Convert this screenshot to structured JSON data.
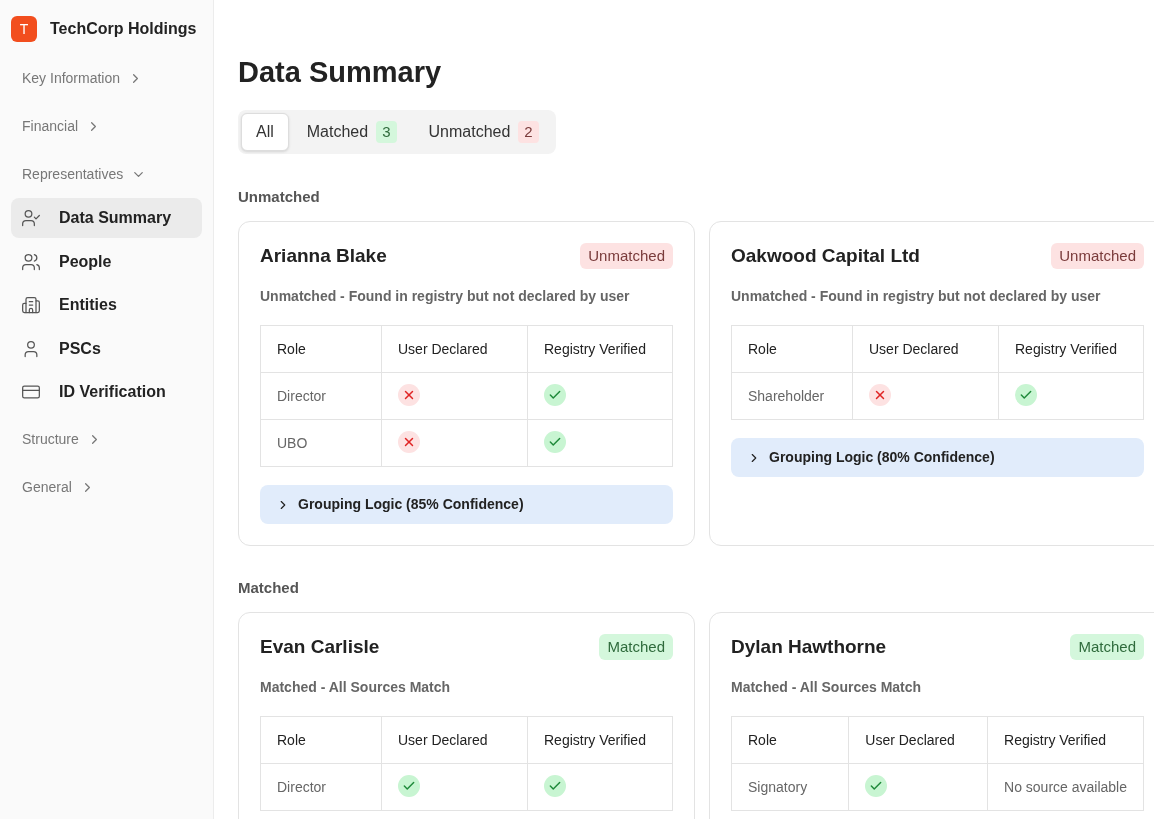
{
  "company": {
    "initial": "T",
    "name": "TechCorp Holdings"
  },
  "nav": [
    {
      "label": "Key Information",
      "expanded": false
    },
    {
      "label": "Financial",
      "expanded": false
    },
    {
      "label": "Representatives",
      "expanded": true,
      "children": [
        {
          "label": "Data Summary",
          "kind": "summary",
          "selected": true
        },
        {
          "label": "People",
          "kind": "people",
          "selected": false
        },
        {
          "label": "Entities",
          "kind": "entities",
          "selected": false
        },
        {
          "label": "PSCs",
          "kind": "pscs",
          "selected": false
        },
        {
          "label": "ID Verification",
          "kind": "verification",
          "selected": false
        }
      ]
    },
    {
      "label": "Structure",
      "expanded": false
    },
    {
      "label": "General",
      "expanded": false
    }
  ],
  "title": "Data Summary",
  "filters": [
    {
      "label": "All",
      "selected": true
    },
    {
      "label": "Matched",
      "count": "3",
      "kind": "matched",
      "selected": false
    },
    {
      "label": "Unmatched",
      "count": "2",
      "kind": "unmatched",
      "selected": false
    }
  ],
  "sections": [
    {
      "label": "Unmatched",
      "cards": [
        {
          "name": "Arianna Blake",
          "status": "Unmatched",
          "kind": "unmatched",
          "description": "Unmatched - Found in registry but not declared by user",
          "columns": [
            "Role",
            "User Declared",
            "Registry Verified"
          ],
          "rows": [
            {
              "role": "Director",
              "declared": {
                "kind": "cross"
              },
              "verified": {
                "kind": "check"
              }
            },
            {
              "role": "UBO",
              "declared": {
                "kind": "cross"
              },
              "verified": {
                "kind": "check"
              }
            }
          ],
          "grouping": {
            "label": "Grouping Logic (85% Confidence)",
            "expanded": false
          }
        },
        {
          "name": "Oakwood Capital Ltd",
          "status": "Unmatched",
          "kind": "unmatched",
          "description": "Unmatched - Found in registry but not declared by user",
          "columns": [
            "Role",
            "User Declared",
            "Registry Verified"
          ],
          "rows": [
            {
              "role": "Shareholder",
              "declared": {
                "kind": "cross"
              },
              "verified": {
                "kind": "check"
              }
            }
          ],
          "grouping": {
            "label": "Grouping Logic (80% Confidence)",
            "expanded": false
          }
        }
      ]
    },
    {
      "label": "Matched",
      "cards": [
        {
          "name": "Evan Carlisle",
          "status": "Matched",
          "kind": "matched",
          "description": "Matched - All Sources Match",
          "columns": [
            "Role",
            "User Declared",
            "Registry Verified"
          ],
          "rows": [
            {
              "role": "Director",
              "declared": {
                "kind": "check"
              },
              "verified": {
                "kind": "check"
              }
            }
          ]
        },
        {
          "name": "Dylan Hawthorne",
          "status": "Matched",
          "kind": "matched",
          "description": "Matched - All Sources Match",
          "columns": [
            "Role",
            "User Declared",
            "Registry Verified"
          ],
          "rows": [
            {
              "role": "Signatory",
              "declared": {
                "kind": "check"
              },
              "verified": {
                "kind": "text",
                "text": "No source available"
              }
            }
          ]
        }
      ]
    }
  ]
}
